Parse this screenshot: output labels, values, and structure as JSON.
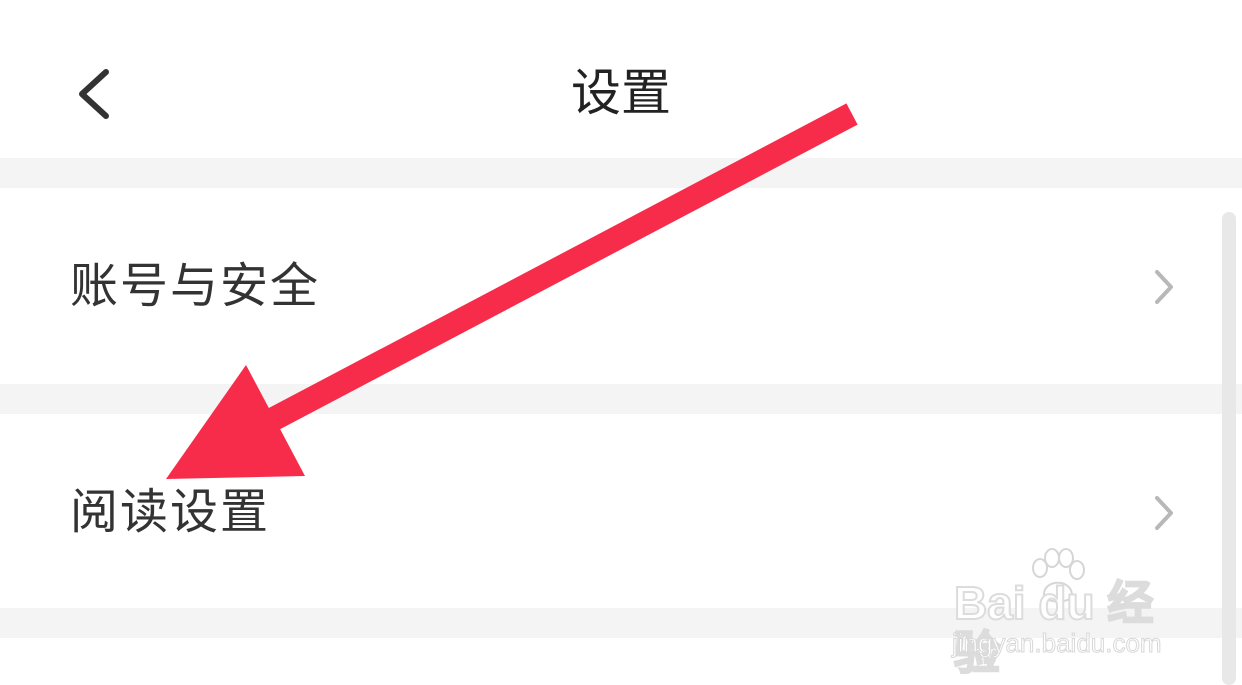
{
  "header": {
    "title": "设置",
    "back_icon": "chevron-left-icon"
  },
  "settings": {
    "items": [
      {
        "label": "账号与安全",
        "icon": "chevron-right-icon"
      },
      {
        "label": "阅读设置",
        "icon": "chevron-right-icon"
      }
    ]
  },
  "annotation": {
    "icon": "red-arrow-icon",
    "color": "#f72c4a"
  },
  "watermark": {
    "brand": "Bai du 经验",
    "site": "jingyan.baidu.com",
    "icon": "paw-icon"
  },
  "colors": {
    "background": "#ffffff",
    "divider": "#f4f4f4",
    "text": "#333333",
    "chevron": "#b8b8b8"
  }
}
